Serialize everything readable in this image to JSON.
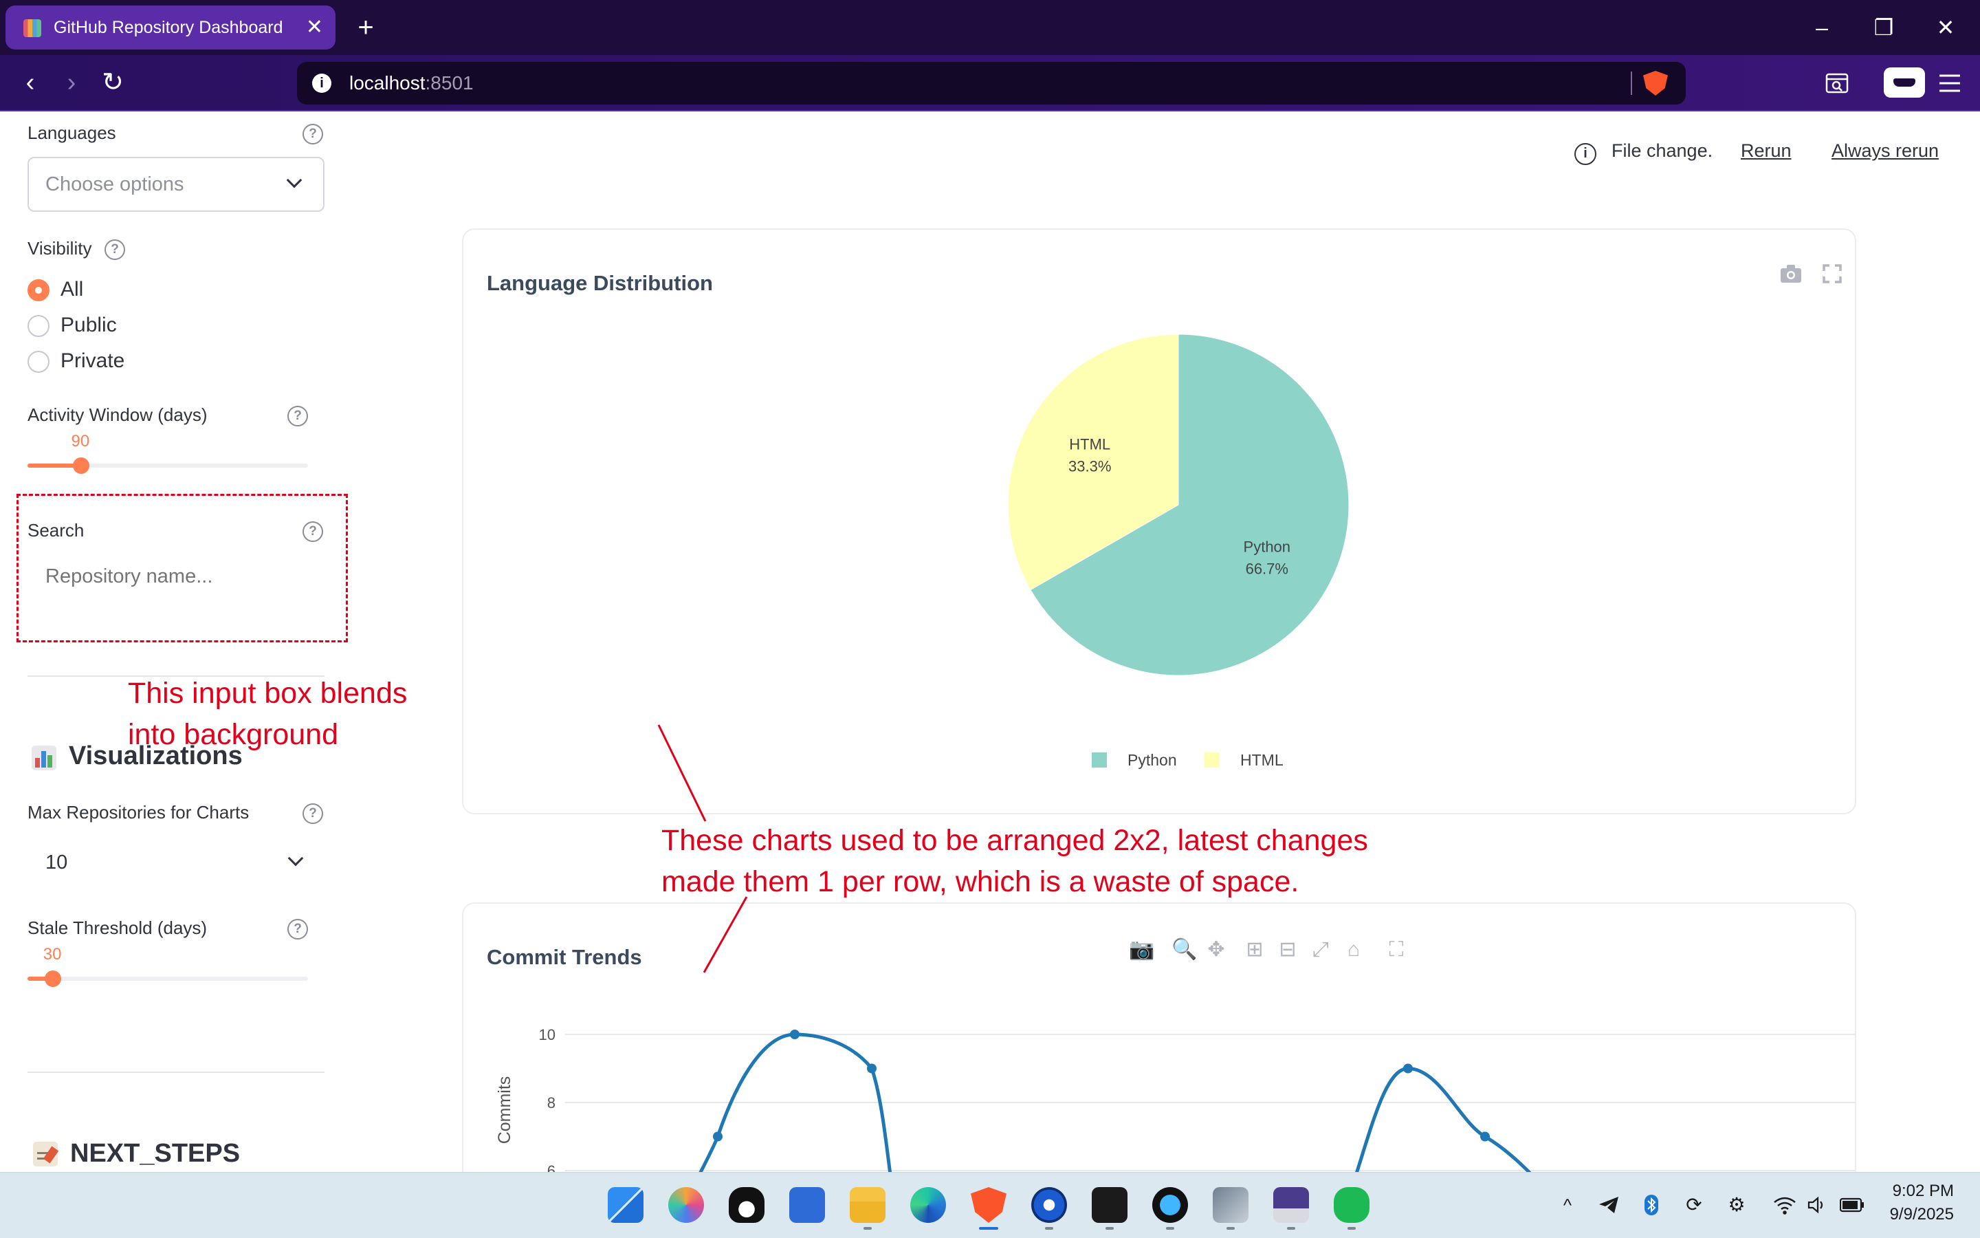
{
  "browser": {
    "tab_title": "GitHub Repository Dashboard",
    "tab_close": "✕",
    "new_tab": "+",
    "url_host": "localhost",
    "url_port": ":8501",
    "controls": {
      "minimize": "–",
      "restore": "❐",
      "close": "✕"
    },
    "nav": {
      "back": "‹",
      "forward": "›",
      "reload": "↻"
    }
  },
  "sidebar": {
    "languages": {
      "label": "Languages",
      "placeholder": "Choose options"
    },
    "visibility": {
      "label": "Visibility",
      "options": [
        "All",
        "Public",
        "Private"
      ],
      "selected": "All"
    },
    "activity_window": {
      "label": "Activity Window (days)",
      "value": "90",
      "value_fraction": 0.19
    },
    "search": {
      "label": "Search",
      "placeholder": "Repository name..."
    },
    "visualizations": {
      "heading": "Visualizations",
      "max_repos": {
        "label": "Max Repositories for Charts",
        "value": "10"
      },
      "stale_threshold": {
        "label": "Stale Threshold (days)",
        "value": "30",
        "value_fraction": 0.09
      }
    },
    "next_steps": {
      "heading": "NEXT_STEPS"
    },
    "help_glyph": "?"
  },
  "status_bar": {
    "info_glyph": "i",
    "message": "File change.",
    "rerun": "Rerun",
    "always_rerun": "Always rerun"
  },
  "language_chart": {
    "title": "Language Distribution",
    "modebar": [
      "camera-icon",
      "fullscreen-icon"
    ]
  },
  "commit_chart": {
    "title": "Commit Trends",
    "modebar": [
      "camera-icon",
      "zoom-icon",
      "pan-icon",
      "zoom-in-icon",
      "zoom-out-icon",
      "autoscale-icon",
      "reset-axes-icon",
      "fullscreen-icon"
    ]
  },
  "chart_data": [
    {
      "type": "pie",
      "title": "Language Distribution",
      "categories": [
        "Python",
        "HTML"
      ],
      "values": [
        66.7,
        33.3
      ],
      "labels": [
        "66.7%",
        "33.3%"
      ],
      "colors": [
        "#8dd3c7",
        "#ffffb3"
      ],
      "legend": "bottom-center"
    },
    {
      "type": "line",
      "title": "Commit Trends",
      "ylabel": "Commits",
      "ytick_labels": [
        "10",
        "8",
        "6"
      ],
      "ylim": [
        6,
        10
      ],
      "color": "#1f77b4",
      "grid": true,
      "series": [
        {
          "values": [
            7,
            10,
            9
          ]
        },
        {
          "values": [
            9,
            7
          ]
        }
      ]
    }
  ],
  "annotations": {
    "input_note": [
      "This input box blends",
      "into background"
    ],
    "layout_note": [
      "These charts used to be arranged 2x2, latest changes",
      "made them 1 per row, which is a waste of space."
    ]
  },
  "taskbar": {
    "time": "9:02 PM",
    "date": "9/9/2025",
    "tray_overflow": "^",
    "apps": [
      "windows-start",
      "copilot",
      "linux-penguin",
      "powershell",
      "file-explorer",
      "edge",
      "brave",
      "1password",
      "terminal",
      "messaging-app",
      "virtualbox",
      "image-editor",
      "evernote"
    ]
  }
}
